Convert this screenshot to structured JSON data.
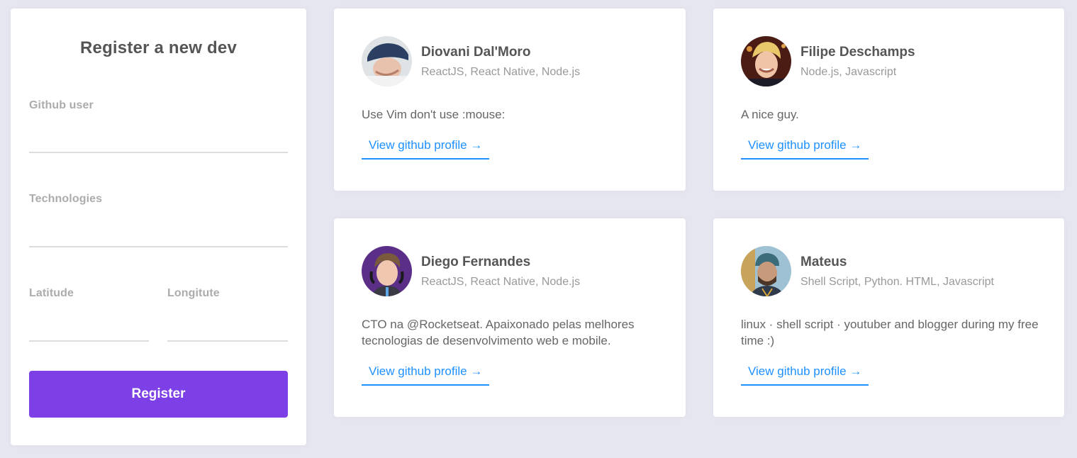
{
  "form": {
    "title": "Register a new dev",
    "github_label": "Github user",
    "github_value": "",
    "techs_label": "Technologies",
    "techs_value": "",
    "latitude_label": "Latitude",
    "latitude_value": "",
    "longitude_label": "Longitute",
    "longitude_value": "",
    "submit_label": "Register"
  },
  "devs": [
    {
      "name": "Diovani Dal'Moro",
      "techs": "ReactJS, React Native, Node.js",
      "bio": "Use Vim don't use :mouse:",
      "link": "View github profile →",
      "avatar": "user-photo"
    },
    {
      "name": "Filipe Deschamps",
      "techs": "Node.js, Javascript",
      "bio": "A nice guy.",
      "link": "View github profile →",
      "avatar": "user-photo"
    },
    {
      "name": "Diego Fernandes",
      "techs": "ReactJS, React Native, Node.js",
      "bio": "CTO na @Rocketseat. Apaixonado pelas melhores tecnologias de desenvolvimento web e mobile.",
      "link": "View github profile →",
      "avatar": "user-photo"
    },
    {
      "name": "Mateus",
      "techs": "Shell Script, Python. HTML, Javascript",
      "bio": "linux · shell script · youtuber and blogger during my free time :)",
      "link": "View github profile →",
      "avatar": "user-photo"
    }
  ],
  "colors": {
    "background": "#e6e6f0",
    "accent": "#7d40e7",
    "link": "#1e90ff"
  }
}
